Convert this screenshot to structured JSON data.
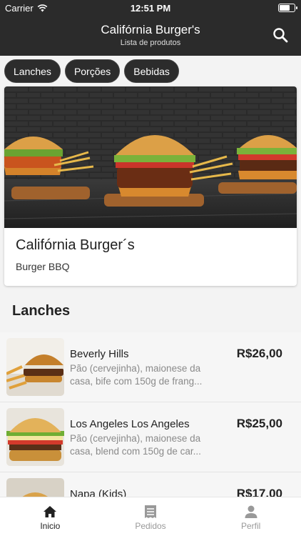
{
  "status_bar": {
    "carrier": "Carrier",
    "time": "12:51 PM",
    "battery_level": 0.75
  },
  "header": {
    "title": "Califórnia Burger's",
    "subtitle": "Lista de produtos",
    "search_icon": "search-icon"
  },
  "categories": [
    {
      "label": "Lanches"
    },
    {
      "label": "Porções"
    },
    {
      "label": "Bebidas"
    }
  ],
  "featured": {
    "name": "Califórnia Burger´s",
    "subtitle": "Burger BBQ"
  },
  "section_title": "Lanches",
  "products": [
    {
      "name": "Beverly Hills",
      "description": "Pão (cervejinha), maionese da casa, bife com 150g de frang...",
      "price": "R$26,00"
    },
    {
      "name": "Los Angeles Los Angeles",
      "description": "Pão (cervejinha), maionese da casa, blend com 150g de car...",
      "price": "R$25,00"
    },
    {
      "name": "Napa (Kids)",
      "description": "",
      "price": "R$17,00"
    }
  ],
  "tabs": [
    {
      "label": "Inicio",
      "icon": "home-icon",
      "active": true
    },
    {
      "label": "Pedidos",
      "icon": "receipt-icon",
      "active": false
    },
    {
      "label": "Perfil",
      "icon": "person-icon",
      "active": false
    }
  ],
  "colors": {
    "header_bg": "#2b2b2b",
    "chip_bg": "#2c2c2c",
    "tab_active": "#222222",
    "tab_inactive": "#999999"
  }
}
